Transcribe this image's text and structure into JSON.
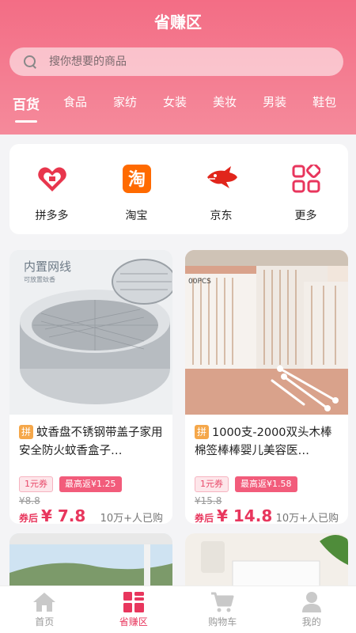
{
  "header": {
    "title": "省赚区"
  },
  "search": {
    "placeholder": "搜你想要的商品"
  },
  "tabs": [
    {
      "label": "百货",
      "active": true
    },
    {
      "label": "食品"
    },
    {
      "label": "家纺"
    },
    {
      "label": "女装"
    },
    {
      "label": "美妆"
    },
    {
      "label": "男装"
    },
    {
      "label": "鞋包"
    }
  ],
  "platforms": [
    {
      "label": "拼多多",
      "icon": "pinduoduo-icon",
      "color": "#e8364d"
    },
    {
      "label": "淘宝",
      "icon": "taobao-icon",
      "color": "#ff6a00"
    },
    {
      "label": "京东",
      "icon": "jingdong-icon",
      "color": "#e1251b"
    },
    {
      "label": "更多",
      "icon": "more-grid-icon",
      "color": "#e8365d"
    }
  ],
  "products": [
    {
      "platform_tag": "拼",
      "image_text": "内置网线",
      "image_subtext": "可放置蚊香",
      "name": "蚊香盘不锈钢带盖子家用安全防火蚊香盒子…",
      "coupon": "1元券",
      "rebate": "最高返¥1.25",
      "original_price": "¥8.8",
      "after_label": "券后",
      "price": "¥ 7.8",
      "sold": "10万+人已购"
    },
    {
      "platform_tag": "拼",
      "image_text": "00PCS",
      "name": "1000支-2000双头木棒棉签棒棒婴儿美容医…",
      "coupon": "1元券",
      "rebate": "最高返¥1.58",
      "original_price": "¥15.8",
      "after_label": "券后",
      "price": "¥ 14.8",
      "sold": "10万+人已购"
    }
  ],
  "bottom_nav": [
    {
      "label": "首页",
      "icon": "home-icon"
    },
    {
      "label": "省赚区",
      "icon": "grid-icon",
      "active": true
    },
    {
      "label": "购物车",
      "icon": "cart-icon"
    },
    {
      "label": "我的",
      "icon": "user-icon"
    }
  ],
  "colors": {
    "accent": "#e8365d",
    "header": "#f36d85"
  }
}
